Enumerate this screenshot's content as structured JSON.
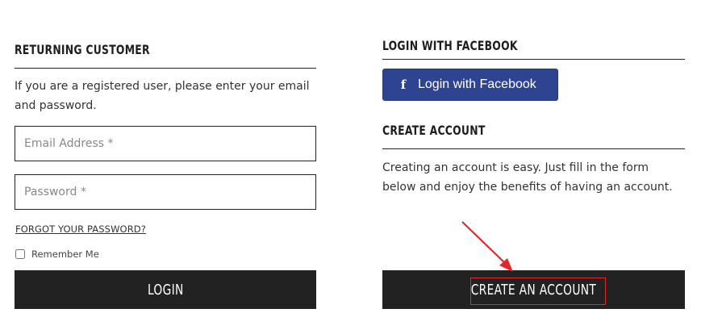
{
  "returning": {
    "heading": "RETURNING CUSTOMER",
    "intro": "If you are a registered user, please enter your email and password.",
    "email_placeholder": "Email Address *",
    "password_placeholder": "Password *",
    "forgot_label": "FORGOT YOUR PASSWORD?",
    "remember_label": "Remember Me",
    "remember_checked": false,
    "login_label": "LOGIN"
  },
  "facebook": {
    "heading": "LOGIN WITH FACEBOOK",
    "icon": "f",
    "button_label": "Login with Facebook"
  },
  "create": {
    "heading": "CREATE ACCOUNT",
    "intro": "Creating an account is easy. Just fill in the form below and enjoy the benefits of having an account.",
    "button_label": "CREATE AN ACCOUNT"
  },
  "colors": {
    "dark": "#222222",
    "facebook": "#2f4490",
    "annotation": "#e0282b"
  }
}
